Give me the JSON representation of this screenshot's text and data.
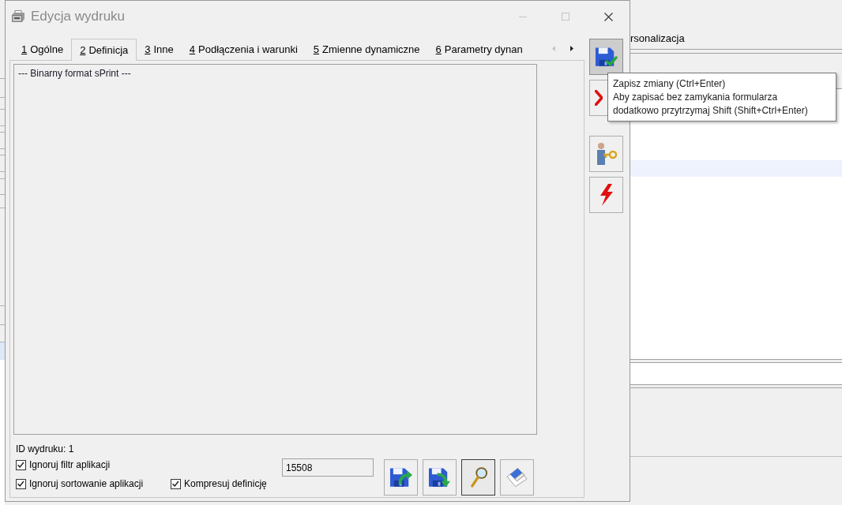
{
  "window": {
    "title": "Edycja wydruku"
  },
  "caption_buttons": [
    {
      "kind": "minimize",
      "disabled": true
    },
    {
      "kind": "maximize",
      "disabled": true
    },
    {
      "kind": "close",
      "disabled": false
    }
  ],
  "tabs": [
    {
      "key": "1",
      "label": "Ogólne",
      "selected": false
    },
    {
      "key": "2",
      "label": "Definicja",
      "selected": true
    },
    {
      "key": "3",
      "label": "Inne",
      "selected": false
    },
    {
      "key": "4",
      "label": "Podłączenia i warunki",
      "selected": false
    },
    {
      "key": "5",
      "label": "Zmienne dynamiczne",
      "selected": false
    },
    {
      "key": "6",
      "label": "Parametry dynan",
      "selected": false
    }
  ],
  "tab_scroll": [
    {
      "kind": "left",
      "disabled": true
    },
    {
      "kind": "right",
      "disabled": false
    }
  ],
  "definition": {
    "text": "--- Binarny format sPrint ---"
  },
  "print_id": "ID wydruku: 1",
  "options": [
    {
      "label": "Ignoruj filtr aplikacji",
      "checked": true
    },
    {
      "label": "Ignoruj sortowanie aplikacji",
      "checked": true
    },
    {
      "label": "Kompresuj definicję",
      "checked": true
    }
  ],
  "number_field": {
    "value": "15508"
  },
  "bottom_buttons": [
    {
      "kind": "import",
      "focused": false
    },
    {
      "kind": "export",
      "focused": false
    },
    {
      "kind": "preview",
      "focused": true
    },
    {
      "kind": "clear",
      "focused": false
    }
  ],
  "side_buttons": [
    {
      "kind": "save",
      "highlighted": true
    },
    {
      "kind": "cancel",
      "highlighted": false
    },
    {
      "kind": "permissions",
      "highlighted": false
    },
    {
      "kind": "execute",
      "highlighted": false
    }
  ],
  "tooltip": {
    "lines": [
      "Zapisz zmiany (Ctrl+Enter)",
      "Aby zapisać bez zamykania formularza",
      "dodatkowo przytrzymaj Shift (Shift+Ctrl+Enter)"
    ]
  },
  "background_window": {
    "tab": "rsonalizacja"
  }
}
